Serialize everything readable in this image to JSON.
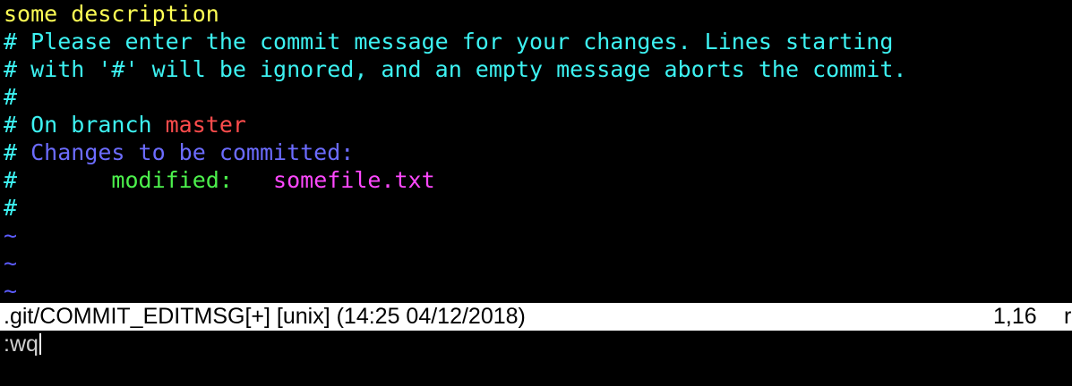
{
  "editor": {
    "line1": "some description",
    "line2": "# Please enter the commit message for your changes. Lines starting",
    "line3": "# with '#' will be ignored, and an empty message aborts the commit.",
    "line4": "#",
    "line5_prefix": "# On branch ",
    "line5_branch": "master",
    "line6_hash": "# ",
    "line6_text": "Changes to be committed:",
    "line7_hash": "#",
    "line7_status": "       modified:   ",
    "line7_file": "somefile.txt",
    "line8": "#",
    "tilde": "~"
  },
  "status_bar": {
    "left": ".git/COMMIT_EDITMSG[+] [unix] (14:25 04/12/2018)",
    "position": "1,16",
    "truncated": "r"
  },
  "command_line": {
    "text": ":wq"
  },
  "colors": {
    "first_line": "#FFFF55",
    "comment": "#3DF2F2",
    "branch": "#FF4C4C",
    "header": "#6C6CFF",
    "modified_label": "#4CF04C",
    "file_name": "#FF48FF",
    "tilde": "#5C5CFF",
    "status_bg": "#FFFFFF"
  }
}
